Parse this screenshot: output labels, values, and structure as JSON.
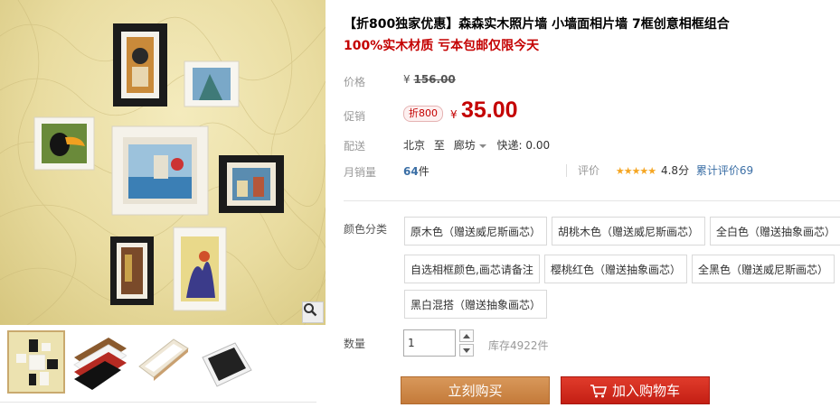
{
  "product": {
    "title": "【折800独家优惠】森森实木照片墙 小墙面相片墙 7框创意相框组合",
    "subtitle": "100%实木材质 亏本包邮仅限今天"
  },
  "price": {
    "label": "价格",
    "currency": "¥",
    "original": "156.00"
  },
  "promo": {
    "label": "促销",
    "tag": "折800",
    "currency": "¥",
    "price": "35.00"
  },
  "shipping": {
    "label": "配送",
    "from": "北京",
    "to_word": "至",
    "dest": "廊坊",
    "fee": "快递: 0.00"
  },
  "sales": {
    "label": "月销量",
    "count": "64",
    "unit": "件"
  },
  "rating": {
    "label": "评价",
    "stars": "★★★★★",
    "score": "4.8分",
    "total": "累计评价69"
  },
  "options": {
    "label": "颜色分类",
    "items": [
      "原木色（赠送威尼斯画芯）",
      "胡桃木色（赠送威尼斯画芯）",
      "全白色（赠送抽象画芯）",
      "自选相框颜色,画芯请备注",
      "樱桃红色（赠送抽象画芯）",
      "全黑色（赠送威尼斯画芯）",
      "黑白混搭（赠送抽象画芯）"
    ]
  },
  "quantity": {
    "label": "数量",
    "value": "1",
    "stock": "库存4922件"
  },
  "buttons": {
    "buy_now": "立刻购买",
    "add_cart": "加入购物车"
  },
  "colors": {
    "accent_red": "#c40000",
    "buy_btn": "#c47a3a",
    "cart_btn": "#c41f14",
    "link_blue": "#3a6ea5",
    "star": "#f5a623"
  }
}
